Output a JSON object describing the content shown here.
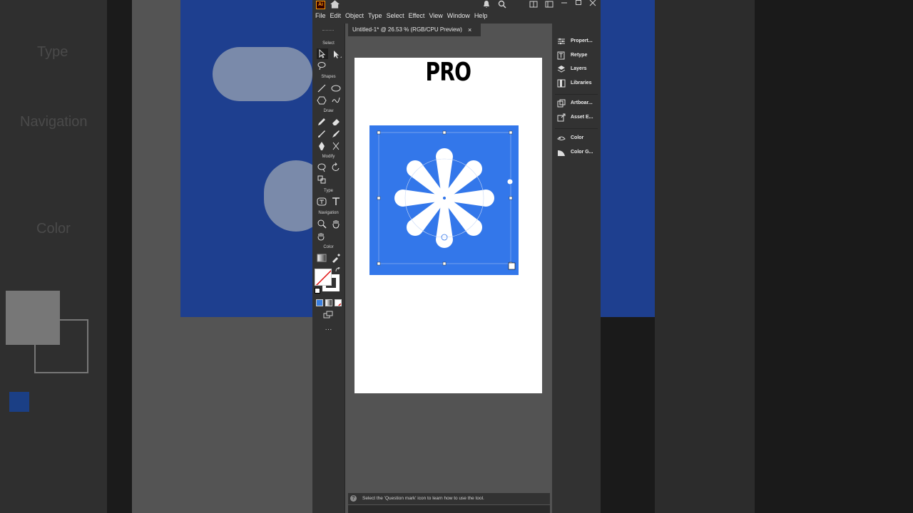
{
  "app": {
    "logo": "Ai",
    "menu": [
      "File",
      "Edit",
      "Object",
      "Type",
      "Select",
      "Effect",
      "View",
      "Window",
      "Help"
    ],
    "doc_tab": "Untitled-1* @ 26.53 % (RGB/CPU Preview)",
    "tab_close": "×"
  },
  "toolbar": {
    "groups": [
      "Select",
      "Shapes",
      "Draw",
      "Modify",
      "Type",
      "Navigation",
      "Color"
    ],
    "more": "···"
  },
  "artboard": {
    "heading": "PRO",
    "shape_color": "#3377ea"
  },
  "status": {
    "help_icon": "?",
    "message": "Select the 'Question mark' icon to learn how to use the tool."
  },
  "right_panel": {
    "items": [
      "Propert...",
      "Retype",
      "Layers",
      "Libraries",
      "Artboar...",
      "Asset E...",
      "Color",
      "Color G..."
    ]
  },
  "background": {
    "labels": [
      "Type",
      "Navigation",
      "Color"
    ]
  },
  "icons": [
    "home-icon",
    "bell-icon",
    "search-icon",
    "layout-icon",
    "minimize-icon",
    "maximize-icon",
    "close-icon",
    "selection-tool-icon",
    "direct-selection-tool-icon",
    "lasso-tool-icon",
    "line-tool-icon",
    "ellipse-tool-icon",
    "polygon-tool-icon",
    "shaper-tool-icon",
    "pencil-tool-icon",
    "eraser-tool-icon",
    "paintbrush-tool-icon",
    "pen-tool-icon",
    "blob-brush-icon",
    "scissors-tool-icon",
    "warp-tool-icon",
    "rotate-tool-icon",
    "scale-tool-icon",
    "type-tool-icon",
    "touch-type-icon",
    "zoom-tool-icon",
    "hand-tool-icon",
    "rotate-view-icon",
    "gradient-icon",
    "eyedropper-icon",
    "fill-swatch-icon",
    "stroke-swatch-icon",
    "swap-icon",
    "default-colors-icon",
    "color-mode-icon",
    "gradient-mode-icon",
    "none-mode-icon",
    "screen-mode-icon"
  ]
}
